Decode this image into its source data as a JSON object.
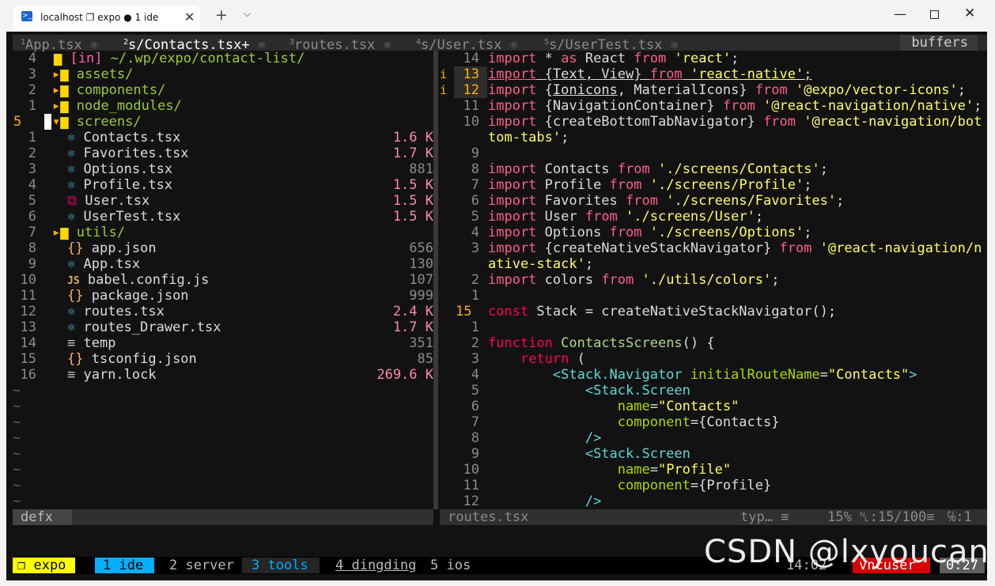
{
  "window": {
    "tab_label": "localhost ❐ expo ● 1 ide",
    "tab_close": "✕",
    "new_tab": "+",
    "dropdown": "⌵",
    "minimize": "—",
    "close": "✕"
  },
  "tabline": {
    "buffers": [
      {
        "num": "1",
        "name": "App.tsx"
      },
      {
        "num": "2",
        "name": "s/Contacts.tsx+",
        "active": true
      },
      {
        "num": "3",
        "name": "routes.tsx"
      },
      {
        "num": "4",
        "name": "s/User.tsx"
      },
      {
        "num": "5",
        "name": "s/UserTest.tsx"
      }
    ],
    "buffers_label": "buffers"
  },
  "explorer": {
    "header": {
      "num": "4",
      "in": "[in]",
      "path": "~/.wp/expo/contact-list/"
    },
    "items": [
      {
        "num": "3",
        "name": "assets/",
        "type": "dir"
      },
      {
        "num": "2",
        "name": "components/",
        "type": "dir"
      },
      {
        "num": "1",
        "name": "node_modules/",
        "type": "dir"
      },
      {
        "num": "5",
        "name": "screens/",
        "type": "dir-open"
      },
      {
        "num": "1",
        "name": "Contacts.tsx",
        "size": "1.6 K",
        "icon": "react-icon"
      },
      {
        "num": "2",
        "name": "Favorites.tsx",
        "size": "1.7 K",
        "icon": "react-icon"
      },
      {
        "num": "3",
        "name": "Options.tsx",
        "size": "881",
        "icon": "react-icon"
      },
      {
        "num": "4",
        "name": "Profile.tsx",
        "size": "1.5 K",
        "icon": "react-icon"
      },
      {
        "num": "5",
        "name": "User.tsx",
        "size": "1.5 K",
        "icon": "copy-icon"
      },
      {
        "num": "6",
        "name": "UserTest.tsx",
        "size": "1.5 K",
        "icon": "react-icon"
      },
      {
        "num": "7",
        "name": "utils/",
        "type": "dir"
      },
      {
        "num": "8",
        "name": "app.json",
        "size": "656",
        "icon": "json-icon"
      },
      {
        "num": "9",
        "name": "App.tsx",
        "size": "130",
        "icon": "react-icon"
      },
      {
        "num": "10",
        "name": "babel.config.js",
        "size": "107",
        "icon": "js-icon"
      },
      {
        "num": "11",
        "name": "package.json",
        "size": "999",
        "icon": "json-icon"
      },
      {
        "num": "12",
        "name": "routes.tsx",
        "size": "2.4 K",
        "icon": "react-icon"
      },
      {
        "num": "13",
        "name": "routes_Drawer.tsx",
        "size": "1.7 K",
        "icon": "react-icon"
      },
      {
        "num": "14",
        "name": "temp",
        "size": "351",
        "icon": "text-icon"
      },
      {
        "num": "15",
        "name": "tsconfig.json",
        "size": "85",
        "icon": "json-icon"
      },
      {
        "num": "16",
        "name": "yarn.lock",
        "size": "269.6 K",
        "icon": "text-icon"
      }
    ],
    "tilde": "~"
  },
  "code": {
    "lines": [
      {
        "num": "14",
        "t": [
          [
            "kw",
            "import"
          ],
          [
            "pl",
            " * "
          ],
          [
            "kw",
            "as"
          ],
          [
            "pl",
            " React "
          ],
          [
            "kw",
            "from"
          ],
          [
            "pl",
            " "
          ],
          [
            "str",
            "'react'"
          ],
          [
            "pl",
            ";"
          ]
        ]
      },
      {
        "num": "13",
        "lsp": "i",
        "t": [
          [
            "kw ul",
            "import"
          ],
          [
            "pl ul",
            " {Text, View} "
          ],
          [
            "kw ul",
            "from"
          ],
          [
            "pl ul",
            " "
          ],
          [
            "str ul",
            "'react-native'"
          ],
          [
            "pl ul",
            ";"
          ]
        ]
      },
      {
        "num": "12",
        "lsp": "i",
        "t": [
          [
            "kw",
            "import"
          ],
          [
            "pl",
            " {"
          ],
          [
            "pl ul",
            "Ionicons"
          ],
          [
            "pl",
            ", MaterialIcons} "
          ],
          [
            "kw",
            "from"
          ],
          [
            "pl",
            " "
          ],
          [
            "str",
            "'@expo/vector-icons'"
          ],
          [
            "pl",
            ";"
          ]
        ]
      },
      {
        "num": "11",
        "t": [
          [
            "kw",
            "import"
          ],
          [
            "pl",
            " {NavigationContainer} "
          ],
          [
            "kw",
            "from"
          ],
          [
            "pl",
            " "
          ],
          [
            "str",
            "'@react-navigation/native'"
          ],
          [
            "pl",
            ";"
          ]
        ]
      },
      {
        "num": "10",
        "t": [
          [
            "kw",
            "import"
          ],
          [
            "pl",
            " {createBottomTabNavigator} "
          ],
          [
            "kw",
            "from"
          ],
          [
            "pl",
            " "
          ],
          [
            "str",
            "'@react-navigation/bot"
          ]
        ]
      },
      {
        "num": "",
        "t": [
          [
            "str",
            "tom-tabs'"
          ],
          [
            "pl",
            ";"
          ]
        ]
      },
      {
        "num": "9",
        "t": []
      },
      {
        "num": "8",
        "t": [
          [
            "kw",
            "import"
          ],
          [
            "pl",
            " Contacts "
          ],
          [
            "kw",
            "from"
          ],
          [
            "pl",
            " "
          ],
          [
            "str",
            "'./screens/Contacts'"
          ],
          [
            "pl",
            ";"
          ]
        ]
      },
      {
        "num": "7",
        "t": [
          [
            "kw",
            "import"
          ],
          [
            "pl",
            " Profile "
          ],
          [
            "kw",
            "from"
          ],
          [
            "pl",
            " "
          ],
          [
            "str",
            "'./screens/Profile'"
          ],
          [
            "pl",
            ";"
          ]
        ]
      },
      {
        "num": "6",
        "t": [
          [
            "kw",
            "import"
          ],
          [
            "pl",
            " Favorites "
          ],
          [
            "kw",
            "from"
          ],
          [
            "pl",
            " "
          ],
          [
            "str",
            "'./screens/Favorites'"
          ],
          [
            "pl",
            ";"
          ]
        ]
      },
      {
        "num": "5",
        "t": [
          [
            "kw",
            "import"
          ],
          [
            "pl",
            " User "
          ],
          [
            "kw",
            "from"
          ],
          [
            "pl",
            " "
          ],
          [
            "str",
            "'./screens/User'"
          ],
          [
            "pl",
            ";"
          ]
        ]
      },
      {
        "num": "4",
        "t": [
          [
            "kw",
            "import"
          ],
          [
            "pl",
            " Options "
          ],
          [
            "kw",
            "from"
          ],
          [
            "pl",
            " "
          ],
          [
            "str",
            "'./screens/Options'"
          ],
          [
            "pl",
            ";"
          ]
        ]
      },
      {
        "num": "3",
        "t": [
          [
            "kw",
            "import"
          ],
          [
            "pl",
            " {createNativeStackNavigator} "
          ],
          [
            "kw",
            "from"
          ],
          [
            "pl",
            " "
          ],
          [
            "str",
            "'@react-navigation/n"
          ]
        ]
      },
      {
        "num": "",
        "t": [
          [
            "str",
            "ative-stack'"
          ],
          [
            "pl",
            ";"
          ]
        ]
      },
      {
        "num": "2",
        "t": [
          [
            "kw",
            "import"
          ],
          [
            "pl",
            " colors "
          ],
          [
            "kw",
            "from"
          ],
          [
            "pl",
            " "
          ],
          [
            "str",
            "'./utils/colors'"
          ],
          [
            "pl",
            ";"
          ]
        ]
      },
      {
        "num": "1",
        "t": []
      },
      {
        "num": "15",
        "cur": true,
        "t": [
          [
            "kw2",
            "const"
          ],
          [
            "pl",
            " Stack = createNativeStackNavigator();"
          ]
        ]
      },
      {
        "num": "1",
        "t": []
      },
      {
        "num": "2",
        "t": [
          [
            "kw2",
            "function"
          ],
          [
            "pl",
            " "
          ],
          [
            "fn",
            "ContactsScreens"
          ],
          [
            "pl",
            "() {"
          ]
        ]
      },
      {
        "num": "3",
        "t": [
          [
            "pl",
            "    "
          ],
          [
            "kw2",
            "return"
          ],
          [
            "pl",
            " ("
          ]
        ]
      },
      {
        "num": "4",
        "t": [
          [
            "pl",
            "        "
          ],
          [
            "tag",
            "<Stack.Navigator"
          ],
          [
            "pl",
            " "
          ],
          [
            "attr",
            "initialRouteName"
          ],
          [
            "pl",
            "="
          ],
          [
            "str",
            "\"Contacts\""
          ],
          [
            "tag",
            ">"
          ]
        ]
      },
      {
        "num": "5",
        "t": [
          [
            "pl",
            "            "
          ],
          [
            "tag",
            "<Stack.Screen"
          ]
        ]
      },
      {
        "num": "6",
        "t": [
          [
            "pl",
            "                "
          ],
          [
            "attr",
            "name"
          ],
          [
            "pl",
            "="
          ],
          [
            "str",
            "\"Contacts\""
          ]
        ]
      },
      {
        "num": "7",
        "t": [
          [
            "pl",
            "                "
          ],
          [
            "attr",
            "component"
          ],
          [
            "pl",
            "={Contacts}"
          ]
        ]
      },
      {
        "num": "8",
        "t": [
          [
            "pl",
            "            "
          ],
          [
            "tag",
            "/>"
          ]
        ]
      },
      {
        "num": "9",
        "t": [
          [
            "pl",
            "            "
          ],
          [
            "tag",
            "<Stack.Screen"
          ]
        ]
      },
      {
        "num": "10",
        "t": [
          [
            "pl",
            "                "
          ],
          [
            "attr",
            "name"
          ],
          [
            "pl",
            "="
          ],
          [
            "str",
            "\"Profile\""
          ]
        ]
      },
      {
        "num": "11",
        "t": [
          [
            "pl",
            "                "
          ],
          [
            "attr",
            "component"
          ],
          [
            "pl",
            "={Profile}"
          ]
        ]
      },
      {
        "num": "12",
        "t": [
          [
            "pl",
            "            "
          ],
          [
            "tag",
            "/>"
          ]
        ]
      }
    ]
  },
  "statusline": {
    "left_mode": "defx",
    "file": "routes.tsx",
    "filetype": "typ… ≡",
    "percent": "15%",
    "line": "␤:15/100≡",
    "col": "℅:1"
  },
  "tmux": {
    "session": "❐ expo",
    "windows": [
      {
        "label": "1 ide"
      },
      {
        "label": "2 server"
      },
      {
        "label": "3 tools"
      },
      {
        "label": "4 dingding"
      },
      {
        "label": "5 ios"
      }
    ],
    "time": "14:02",
    "user": "vncuser",
    "date": "0:27"
  },
  "watermark": "CSDN @lxyoucan"
}
